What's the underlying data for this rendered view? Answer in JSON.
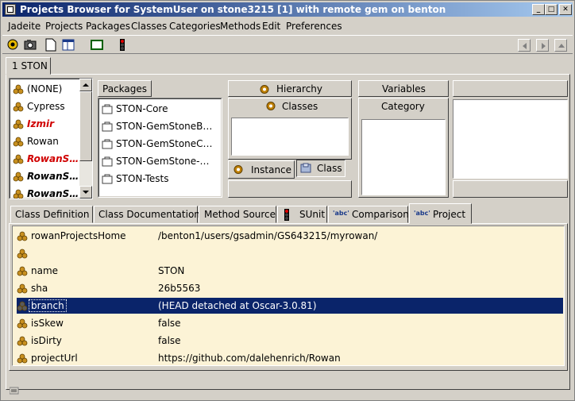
{
  "window": {
    "title": "Projects Browser for SystemUser on stone3215 [1] with remote gem on benton"
  },
  "menu": [
    "Jadeite",
    "Projects",
    "Packages",
    "Classes",
    "Categories",
    "Methods",
    "Edit",
    "Preferences"
  ],
  "outer_tab": "1 STON",
  "projects": [
    {
      "label": "(NONE)",
      "style": "normal"
    },
    {
      "label": "Cypress",
      "style": "normal"
    },
    {
      "label": "Izmir",
      "style": "red"
    },
    {
      "label": "Rowan",
      "style": "normal"
    },
    {
      "label": "RowanS…",
      "style": "red"
    },
    {
      "label": "RowanS…",
      "style": "boldit"
    },
    {
      "label": "RowanS…",
      "style": "boldit"
    }
  ],
  "packages": {
    "header": "Packages",
    "items": [
      "STON-Core",
      "STON-GemStoneB…",
      "STON-GemStoneC…",
      "STON-GemStone-…",
      "STON-Tests"
    ]
  },
  "class_pane": {
    "hierarchy": "Hierarchy",
    "classes": "Classes",
    "instance": "Instance",
    "class": "Class"
  },
  "category_pane": {
    "variables": "Variables",
    "category": "Category"
  },
  "bottom_tabs": [
    {
      "label": "Class Definition"
    },
    {
      "label": "Class Documentation"
    },
    {
      "label": "Method Source"
    },
    {
      "label": "SUnit"
    },
    {
      "label": "Comparison"
    },
    {
      "label": "Project"
    }
  ],
  "project_rows": [
    {
      "key": "rowanProjectsHome",
      "value": "/benton1/users/gsadmin/GS643215/myrowan/"
    },
    {
      "key": "",
      "value": ""
    },
    {
      "key": "name",
      "value": "STON"
    },
    {
      "key": "sha",
      "value": "26b5563"
    },
    {
      "key": "branch",
      "value": "(HEAD detached at Oscar-3.0.81)"
    },
    {
      "key": "isSkew",
      "value": "false"
    },
    {
      "key": "isDirty",
      "value": "false"
    },
    {
      "key": "projectUrl",
      "value": "https://github.com/dalehenrich/Rowan"
    }
  ],
  "colors": {
    "title_start": "#0a246a",
    "selection": "#0a246a",
    "grid_bg": "#fcf3d6",
    "red_text": "#d00000"
  },
  "icons": {
    "title": "window-icon",
    "project": "project-icon",
    "package": "package-icon",
    "gear": "gear-icon",
    "traffic": "traffic-light-icon",
    "abc": "abc-icon",
    "class": "class-icon"
  },
  "icon_text": {
    "abc": "'abc'"
  }
}
